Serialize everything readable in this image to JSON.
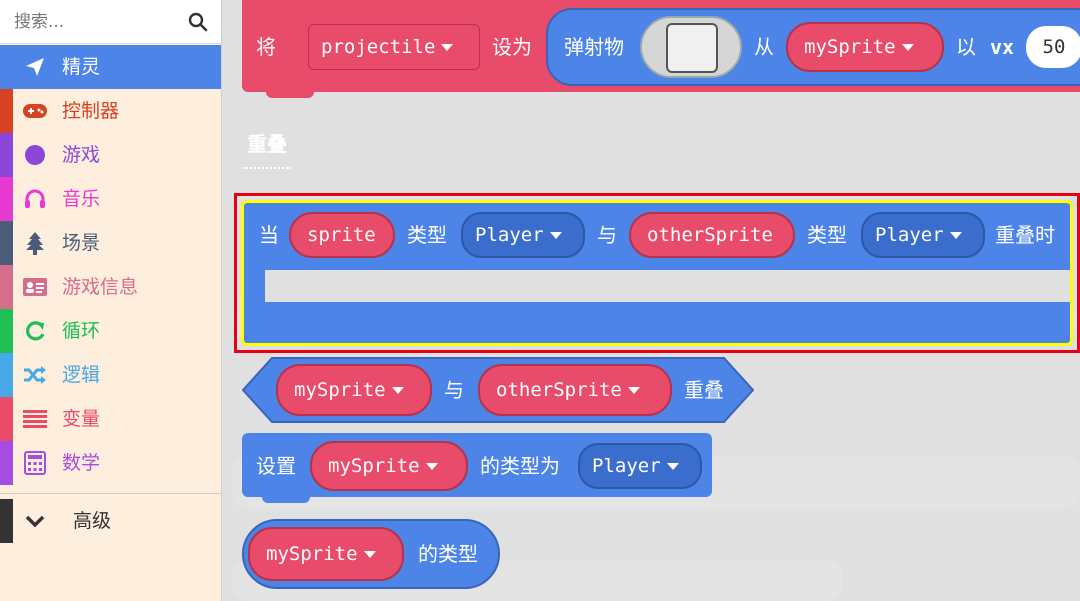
{
  "search": {
    "placeholder": "搜索..."
  },
  "toolbox": {
    "categories": [
      {
        "label": "精灵",
        "icon": "paper-plane-icon",
        "color": "#4c84e8",
        "active": true
      },
      {
        "label": "控制器",
        "icon": "gamepad-icon",
        "color": "#d54322"
      },
      {
        "label": "游戏",
        "icon": "circle-icon",
        "color": "#8b48d8"
      },
      {
        "label": "音乐",
        "icon": "headphones-icon",
        "color": "#e63ad0"
      },
      {
        "label": "场景",
        "icon": "tree-icon",
        "color": "#4b5c7a"
      },
      {
        "label": "游戏信息",
        "icon": "id-card-icon",
        "color": "#d66d8a"
      },
      {
        "label": "循环",
        "icon": "refresh-icon",
        "color": "#20bf55"
      },
      {
        "label": "逻辑",
        "icon": "shuffle-icon",
        "color": "#47a8e8"
      },
      {
        "label": "变量",
        "icon": "list-icon",
        "color": "#e84c6a"
      },
      {
        "label": "数学",
        "icon": "calculator-icon",
        "color": "#a64ce0"
      }
    ],
    "advanced": {
      "label": "高级",
      "icon": "chevron-down-icon",
      "color": "#333333"
    }
  },
  "blocks": {
    "projectile": {
      "prefix": "将",
      "variable": "projectile",
      "set_as": "设为",
      "projectile_label": "弹射物",
      "from": "从",
      "sprite": "mySprite",
      "with": "以",
      "vx_label": "vx",
      "vx_value": "50"
    },
    "section_heading": "重叠",
    "on_overlap": {
      "when": "当",
      "sprite_var": "sprite",
      "type_label": "类型",
      "kind1": "Player",
      "and": "与",
      "other_var": "otherSprite",
      "type_label2": "类型",
      "kind2": "Player",
      "overlap_suffix": "重叠时"
    },
    "overlaps": {
      "sprite": "mySprite",
      "and": "与",
      "other": "otherSprite",
      "suffix": "重叠"
    },
    "set_kind": {
      "prefix": "设置",
      "sprite": "mySprite",
      "middle": "的类型为",
      "kind": "Player"
    },
    "kind_of": {
      "sprite": "mySprite",
      "suffix": "的类型"
    }
  },
  "colors": {
    "sprite_block": "#4c84e8",
    "variable_red": "#e84c6a",
    "highlight_red": "#e60012",
    "highlight_yellow": "#ffff00"
  }
}
